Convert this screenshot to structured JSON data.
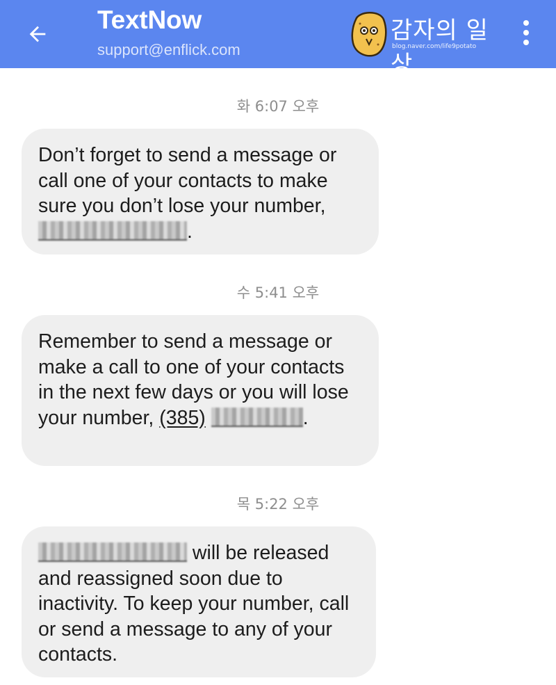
{
  "header": {
    "title": "TextNow",
    "subtitle": "support@enflick.com",
    "watermark_text": "감자의 일상",
    "watermark_sub": "blog.naver.com/life9potato"
  },
  "colors": {
    "appbar": "#5b86ef",
    "bubble": "#efefef",
    "timestamp": "#8e8e8e"
  },
  "messages": [
    {
      "timestamp": "화 6:07 오후",
      "text_before": "Don’t forget to send a message or call one of your contacts to make sure you don’t lose your number,",
      "text_after": "."
    },
    {
      "timestamp": "수 5:41 오후",
      "text_before": "Remember to send a message or make a call to one of your contacts in the next few days or you will lose your number,",
      "link_visible": "(385)",
      "text_after": "."
    },
    {
      "timestamp": "목 5:22 오후",
      "text_after": " will be released and reassigned soon due to inactivity. To keep your number, call or send a message to any of your contacts."
    }
  ]
}
